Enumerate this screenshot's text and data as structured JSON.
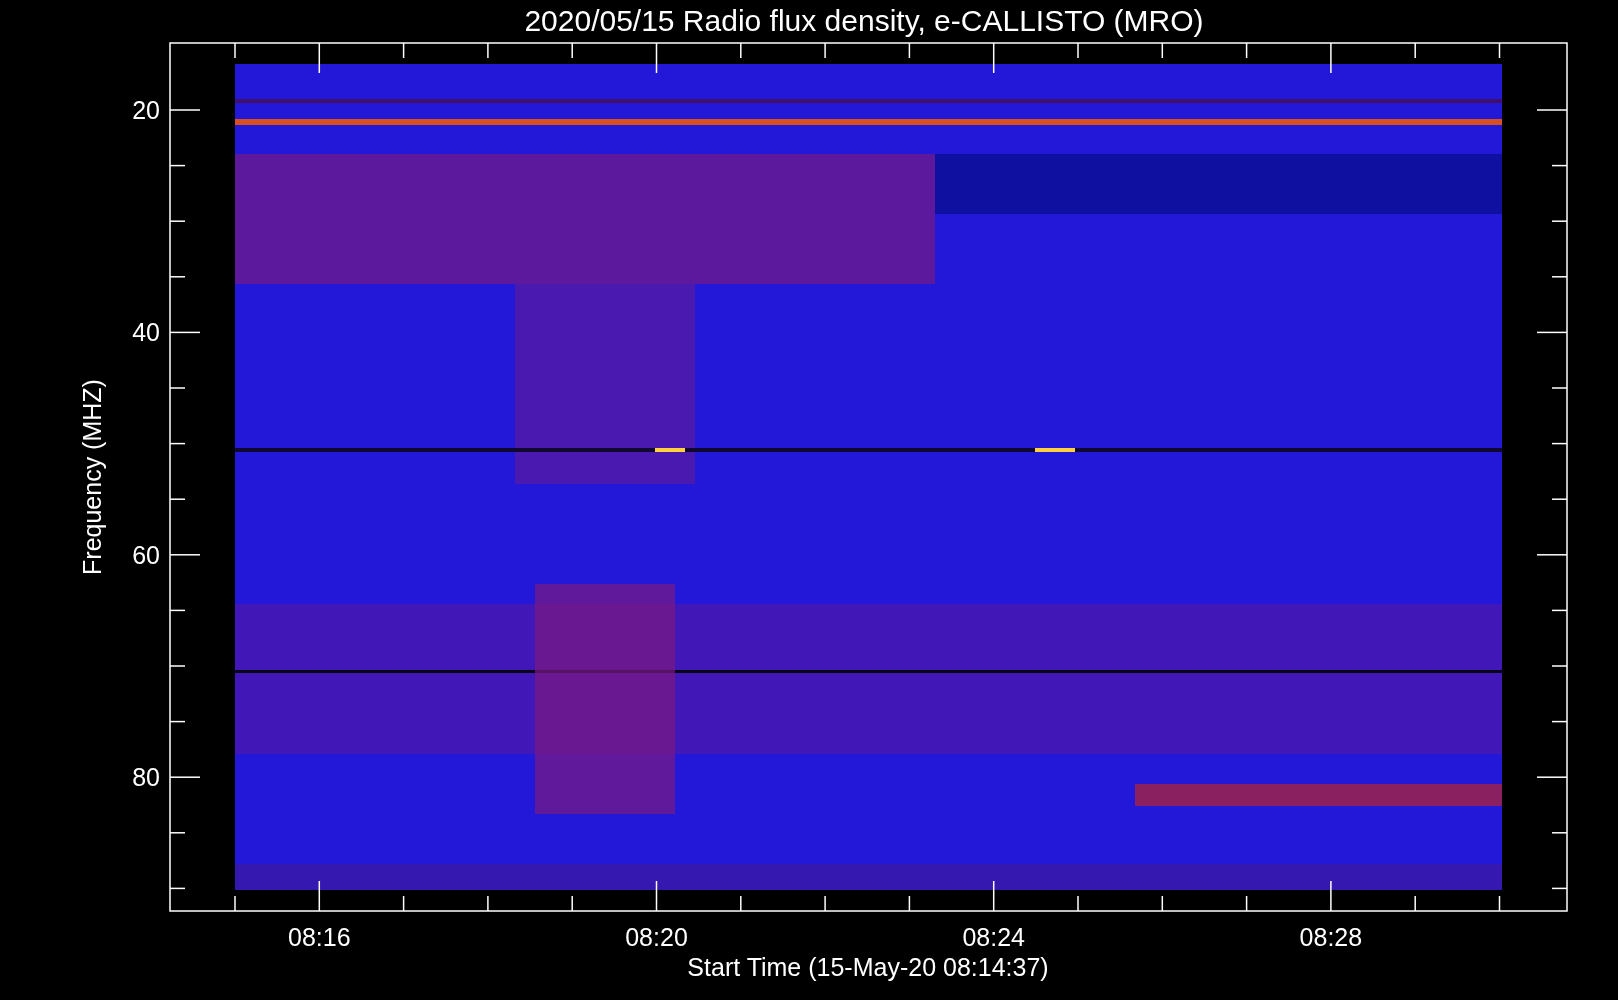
{
  "title": "2020/05/15  Radio flux density, e-CALLISTO (MRO)",
  "y_axis": {
    "label": "Frequency (MHZ)",
    "tick_labels": [
      "20",
      "40",
      "60",
      "80"
    ]
  },
  "x_axis": {
    "label": "Start Time (15-May-20 08:14:37)",
    "tick_labels": [
      "08:16",
      "08:20",
      "08:24",
      "08:28"
    ]
  }
}
